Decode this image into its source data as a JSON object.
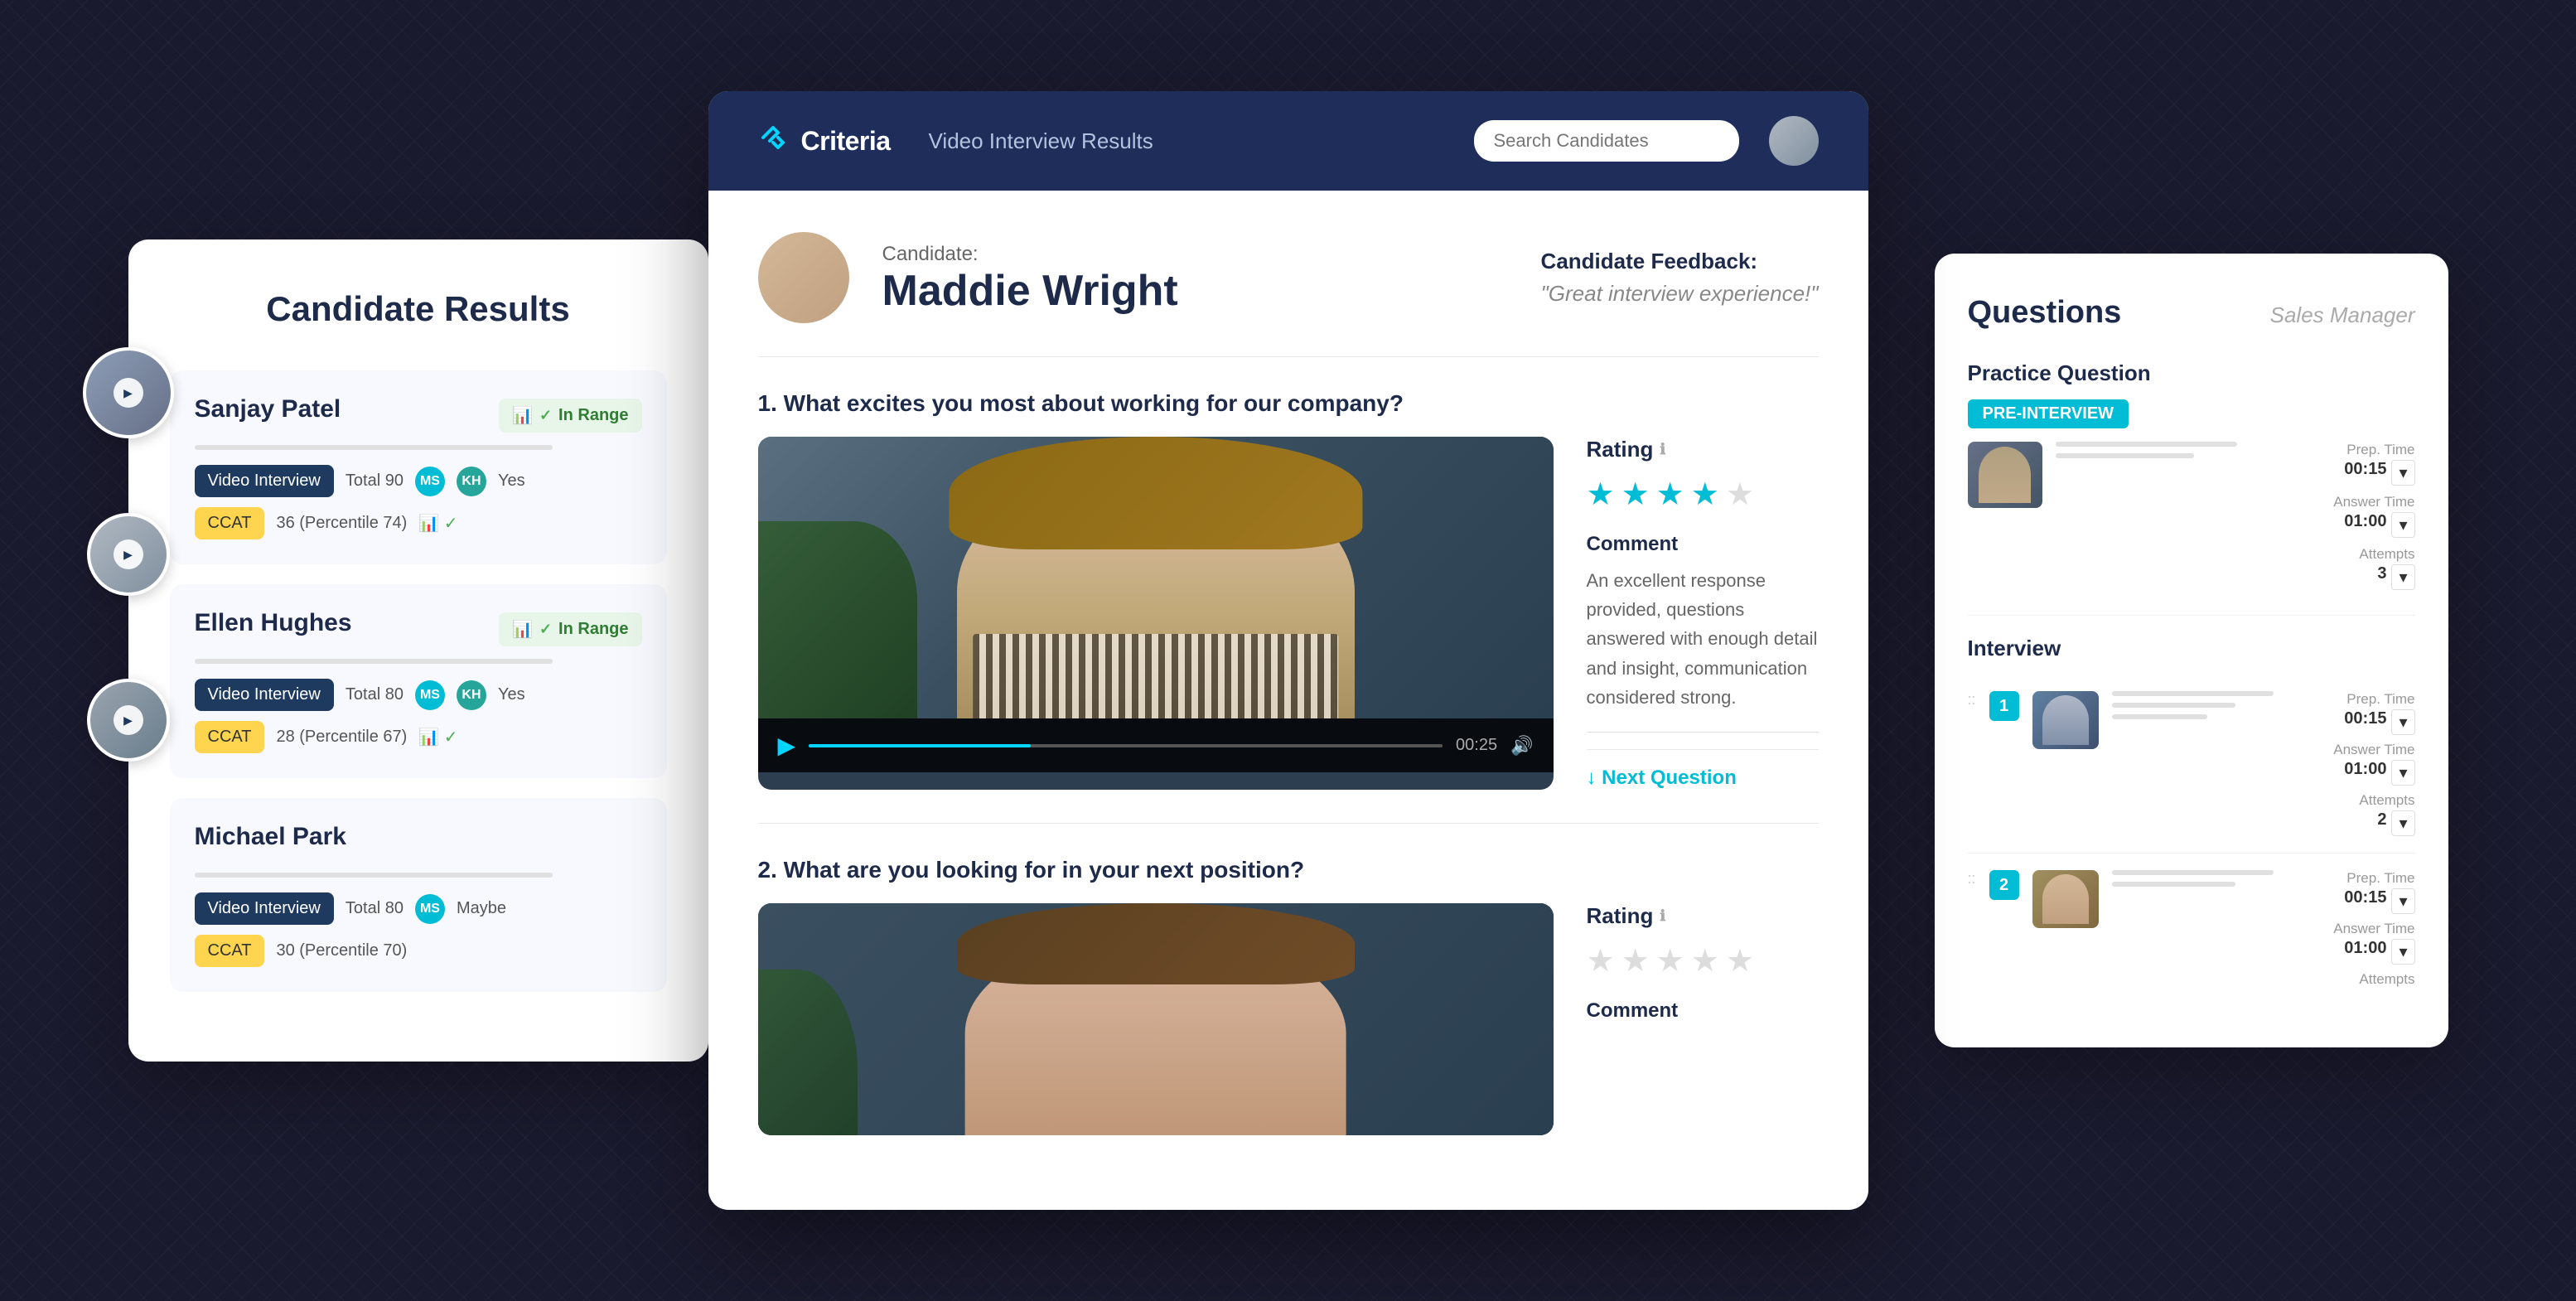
{
  "app": {
    "logo": "Criteria",
    "logo_icon": "✕",
    "header_title": "Video Interview Results",
    "search_placeholder": "Search Candidates",
    "user_avatar": "avatar"
  },
  "candidate_results": {
    "title": "Candidate Results",
    "candidates": [
      {
        "name": "Sanjay Patel",
        "badge": "In Range",
        "video_interview_label": "Video Interview",
        "total": "Total 90",
        "reviewer1": "MS",
        "reviewer2": "KH",
        "verdict": "Yes",
        "ccat_label": "CCAT",
        "ccat_score": "36 (Percentile 74)"
      },
      {
        "name": "Ellen Hughes",
        "badge": "In Range",
        "video_interview_label": "Video Interview",
        "total": "Total 80",
        "reviewer1": "MS",
        "reviewer2": "KH",
        "verdict": "Yes",
        "ccat_label": "CCAT",
        "ccat_score": "28 (Percentile 67)"
      },
      {
        "name": "Michael Park",
        "badge": "",
        "video_interview_label": "Video Interview",
        "total": "Total 80",
        "reviewer1": "MS",
        "reviewer2": "",
        "verdict": "Maybe",
        "ccat_label": "CCAT",
        "ccat_score": "30 (Percentile 70)"
      }
    ]
  },
  "main_panel": {
    "candidate_label": "Candidate:",
    "candidate_name": "Maddie Wright",
    "feedback_label": "Candidate Feedback:",
    "feedback_text": "\"Great interview experience!\"",
    "questions": [
      {
        "number": "1.",
        "text": "What excites you most about working for our company?",
        "time_display": "00:25",
        "rating_label": "Rating",
        "stars_filled": 4,
        "stars_empty": 1,
        "comment_label": "Comment",
        "comment_text": "An excellent response provided, questions answered with enough detail and insight, communication considered strong.",
        "next_question_label": "↓ Next Question"
      },
      {
        "number": "2.",
        "text": "What are you looking for in your next position?",
        "rating_label": "Rating",
        "stars_filled": 0,
        "stars_empty": 5,
        "comment_label": "Comment",
        "comment_text": ""
      }
    ]
  },
  "questions_panel": {
    "title": "Questions",
    "subtitle": "Sales Manager",
    "practice_section": {
      "label": "Practice Question",
      "badge": "PRE-INTERVIEW",
      "prep_time_label": "Prep. Time",
      "prep_time": "00:15",
      "answer_time_label": "Answer Time",
      "answer_time": "01:00",
      "attempts_label": "Attempts",
      "attempts": "3"
    },
    "interview_section": {
      "label": "Interview",
      "items": [
        {
          "number": "1",
          "prep_time_label": "Prep. Time",
          "prep_time": "00:15",
          "answer_time_label": "Answer Time",
          "answer_time": "01:00",
          "attempts_label": "Attempts",
          "attempts": "2"
        },
        {
          "number": "2",
          "prep_time_label": "Prep. Time",
          "prep_time": "00:15",
          "answer_time_label": "Answer Time",
          "answer_time": "01:00",
          "attempts_label": "Attempts",
          "attempts": ""
        }
      ]
    }
  },
  "colors": {
    "primary": "#1e2d5a",
    "accent": "#00bcd4",
    "in_range_bg": "#e8f5e9",
    "in_range_text": "#2e7d32",
    "ccat_bg": "#ffd54f",
    "tag_video_bg": "#1e3a5f"
  }
}
